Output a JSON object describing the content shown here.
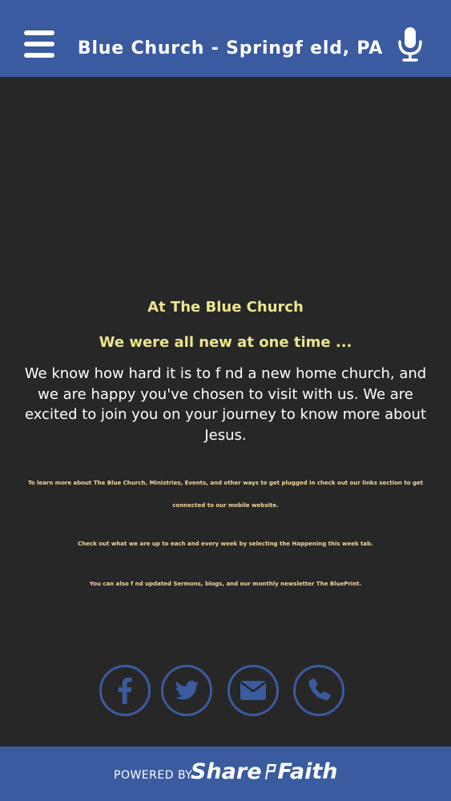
{
  "header": {
    "title": "Blue Church - Springf eld, PA",
    "menu_icon": "hamburger-menu-icon",
    "mic_icon": "microphone-icon"
  },
  "content": {
    "heading1": "At The Blue Church",
    "heading2": "We were all new at one time ...",
    "intro": "We know how hard it is to f nd a new home church, and we are happy you've chosen to visit with us. We are excited to join you on your journey to know more about Jesus.",
    "note1": "To learn more about The Blue Church, Ministries, Events, and other ways to get plugged in check out our links section to get connected to our mobile website.",
    "note2": "Check out what we are up to each and every week by selecting the Happening this week tab.",
    "note3": "You can also f nd updated Sermons, blogs, and our monthly newsletter The BluePrint."
  },
  "social": [
    {
      "icon": "facebook-icon"
    },
    {
      "icon": "twitter-icon"
    },
    {
      "icon": "email-icon"
    },
    {
      "icon": "phone-icon"
    }
  ],
  "footer": {
    "powered_by": "POWERED BY",
    "brand_part1": "Share",
    "brand_part2": "Faith"
  },
  "colors": {
    "header_bg": "#3a5ba0",
    "page_bg": "#272727",
    "heading": "#ebe58d",
    "small_text": "#f2d7a0",
    "icon_blue": "#3a5ba0"
  }
}
